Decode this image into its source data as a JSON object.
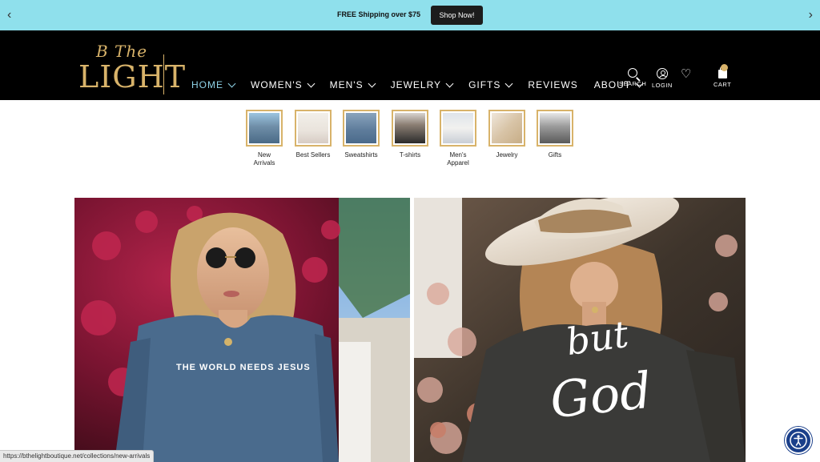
{
  "announcement": {
    "message": "FREE Shipping over $75",
    "button_label": "Shop Now!",
    "prev_icon": "chevron-left-icon",
    "next_icon": "chevron-right-icon",
    "prev_glyph": "‹",
    "next_glyph": "›",
    "background": "#8fe0ec"
  },
  "header": {
    "logo_script": "B The",
    "logo_main": "LIGHT",
    "nav": [
      {
        "label": "HOME",
        "active": true
      },
      {
        "label": "WOMEN'S"
      },
      {
        "label": "MEN'S"
      },
      {
        "label": "JEWELRY"
      },
      {
        "label": "GIFTS"
      },
      {
        "label": "REVIEWS"
      },
      {
        "label": "ABOUT"
      }
    ],
    "search_label": "SEARCH",
    "login_label": "LOGIN",
    "cart_label": "CART",
    "cart_count": "",
    "accent": "#d8b36a"
  },
  "categories": [
    {
      "label": "New\nArrivals"
    },
    {
      "label": "Best Sellers"
    },
    {
      "label": "Sweatshirts"
    },
    {
      "label": "T-shirts"
    },
    {
      "label": "Men's\nApparel"
    },
    {
      "label": "Jewelry"
    },
    {
      "label": "Gifts"
    }
  ],
  "hero": {
    "left_shirt_text": "THE WORLD NEEDS JESUS",
    "right_shirt_text_1": "but",
    "right_shirt_text_2": "God"
  },
  "status_url": "https://bthelightboutique.net/collections/new-arrivals",
  "accessibility_icon": "accessibility-icon"
}
